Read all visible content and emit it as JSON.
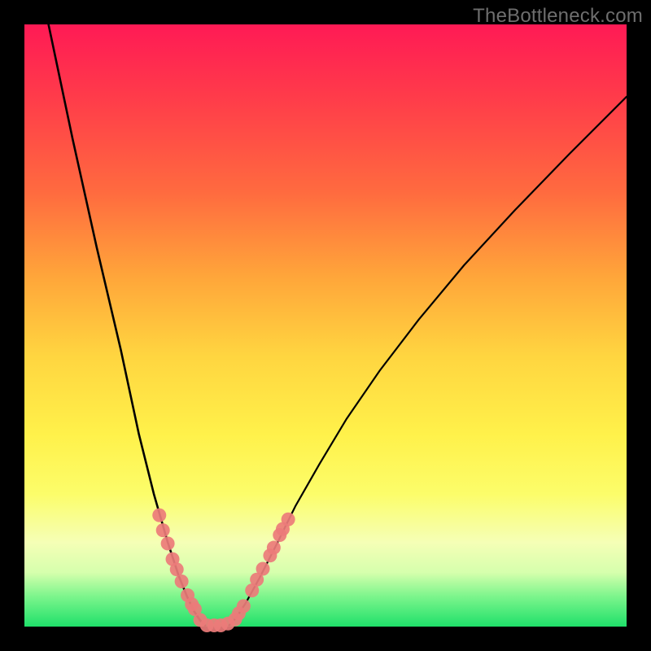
{
  "watermark": "TheBottleneck.com",
  "chart_data": {
    "type": "line",
    "title": "",
    "xlabel": "",
    "ylabel": "",
    "xlim": [
      0,
      100
    ],
    "ylim": [
      0,
      100
    ],
    "grid": false,
    "legend": false,
    "series": [
      {
        "name": "left-curve",
        "x": [
          4,
          8,
          12,
          16,
          19,
          21.5,
          23.8,
          25.6,
          27,
          28.2,
          29.2,
          30
        ],
        "y": [
          100,
          81,
          63,
          46,
          32,
          22,
          14,
          8.5,
          5,
          2.5,
          1,
          0.2
        ]
      },
      {
        "name": "right-curve",
        "x": [
          34,
          35.2,
          36.8,
          39,
          41.8,
          45,
          49,
          53.5,
          59,
          65.5,
          73,
          81.5,
          90.5,
          100
        ],
        "y": [
          0.2,
          1.5,
          4,
          8,
          13.5,
          20,
          27,
          34.5,
          42.5,
          51,
          60,
          69.2,
          78.5,
          88
        ]
      }
    ],
    "markers": {
      "name": "highlight-points",
      "color": "#ec7b7a",
      "points": [
        {
          "x": 22.4,
          "y": 18.5
        },
        {
          "x": 23.0,
          "y": 16
        },
        {
          "x": 23.8,
          "y": 13.8
        },
        {
          "x": 24.6,
          "y": 11.2
        },
        {
          "x": 25.3,
          "y": 9.5
        },
        {
          "x": 26.1,
          "y": 7.5
        },
        {
          "x": 27.1,
          "y": 5.2
        },
        {
          "x": 27.8,
          "y": 3.7
        },
        {
          "x": 28.3,
          "y": 2.9
        },
        {
          "x": 29.2,
          "y": 1.1
        },
        {
          "x": 30.3,
          "y": 0.2
        },
        {
          "x": 31.5,
          "y": 0.2
        },
        {
          "x": 32.6,
          "y": 0.2
        },
        {
          "x": 33.8,
          "y": 0.5
        },
        {
          "x": 35.0,
          "y": 1.2
        },
        {
          "x": 35.6,
          "y": 2.2
        },
        {
          "x": 36.4,
          "y": 3.4
        },
        {
          "x": 37.8,
          "y": 6.0
        },
        {
          "x": 38.6,
          "y": 7.8
        },
        {
          "x": 39.6,
          "y": 9.6
        },
        {
          "x": 40.8,
          "y": 11.8
        },
        {
          "x": 41.4,
          "y": 13.1
        },
        {
          "x": 42.4,
          "y": 15.2
        },
        {
          "x": 42.9,
          "y": 16.2
        },
        {
          "x": 43.8,
          "y": 17.8
        }
      ]
    }
  }
}
